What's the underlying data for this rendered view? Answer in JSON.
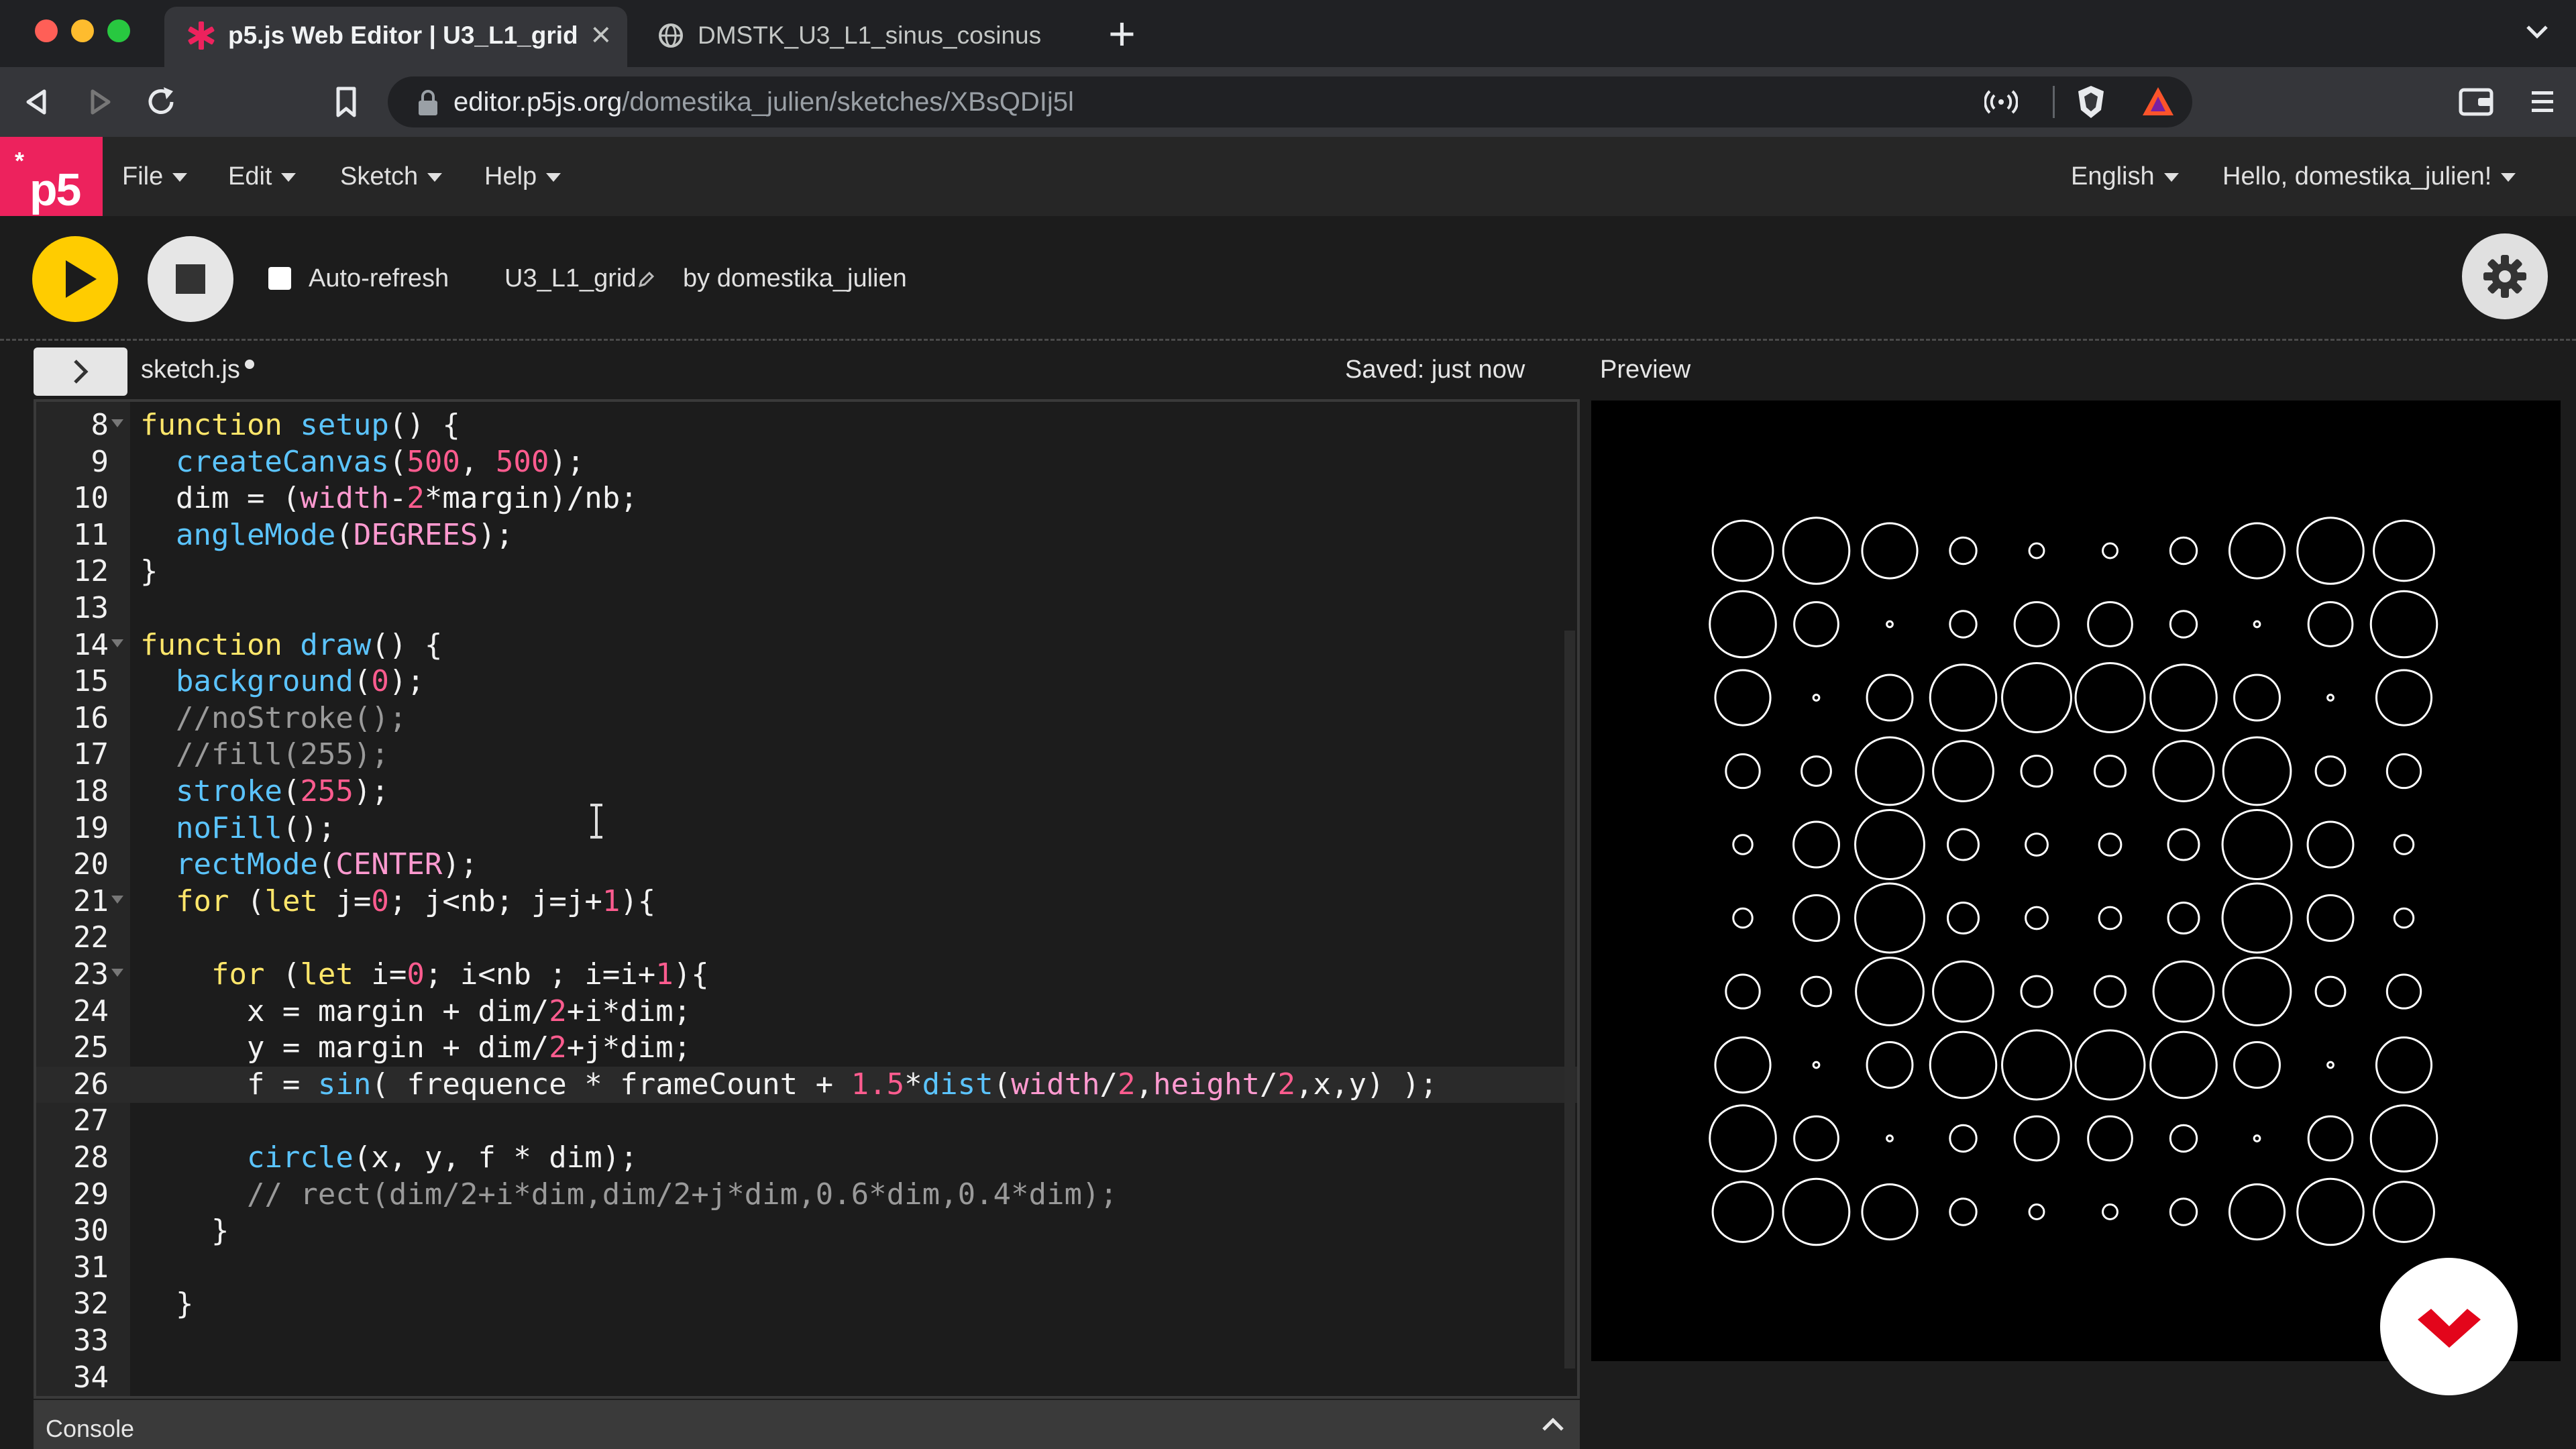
{
  "browser": {
    "tabs": [
      {
        "title": "p5.js Web Editor | U3_L1_grid",
        "active": true,
        "favicon": "p5-asterisk-icon"
      },
      {
        "title": "DMSTK_U3_L1_sinus_cosinus",
        "active": false,
        "favicon": "globe-icon"
      }
    ],
    "url_host": "editor.p5js.org",
    "url_path": "/domestika_julien/sketches/XBsQDIj5l"
  },
  "menu": {
    "logo": "p5",
    "items": [
      "File",
      "Edit",
      "Sketch",
      "Help"
    ],
    "language": "English",
    "user": "Hello, domestika_julien!"
  },
  "toolbar": {
    "auto_refresh_label": "Auto-refresh",
    "auto_refresh_checked": false,
    "sketch_name": "U3_L1_grid",
    "author": "by domestika_julien"
  },
  "editor": {
    "file_name": "sketch.js",
    "saved_status": "Saved: just now",
    "preview_label": "Preview",
    "active_line": 26,
    "lines": [
      {
        "n": "8",
        "fold": true,
        "text": "function setup() {"
      },
      {
        "n": "9",
        "fold": false,
        "text": "  createCanvas(500, 500);"
      },
      {
        "n": "10",
        "fold": false,
        "text": "  dim = (width-2*margin)/nb;"
      },
      {
        "n": "11",
        "fold": false,
        "text": "  angleMode(DEGREES);"
      },
      {
        "n": "12",
        "fold": false,
        "text": "}"
      },
      {
        "n": "13",
        "fold": false,
        "text": ""
      },
      {
        "n": "14",
        "fold": true,
        "text": "function draw() {"
      },
      {
        "n": "15",
        "fold": false,
        "text": "  background(0);"
      },
      {
        "n": "16",
        "fold": false,
        "text": "  //noStroke();"
      },
      {
        "n": "17",
        "fold": false,
        "text": "  //fill(255);"
      },
      {
        "n": "18",
        "fold": false,
        "text": "  stroke(255);"
      },
      {
        "n": "19",
        "fold": false,
        "text": "  noFill();"
      },
      {
        "n": "20",
        "fold": false,
        "text": "  rectMode(CENTER);"
      },
      {
        "n": "21",
        "fold": true,
        "text": "  for (let j=0; j<nb; j=j+1){"
      },
      {
        "n": "22",
        "fold": false,
        "text": ""
      },
      {
        "n": "23",
        "fold": true,
        "text": "    for (let i=0; i<nb ; i=i+1){"
      },
      {
        "n": "24",
        "fold": false,
        "text": "      x = margin + dim/2+i*dim;"
      },
      {
        "n": "25",
        "fold": false,
        "text": "      y = margin + dim/2+j*dim;"
      },
      {
        "n": "26",
        "fold": false,
        "text": "      f = sin( frequence * frameCount + 1.5*dist(width/2,height/2,x,y) );"
      },
      {
        "n": "27",
        "fold": false,
        "text": ""
      },
      {
        "n": "28",
        "fold": false,
        "text": "      circle(x, y, f * dim);"
      },
      {
        "n": "29",
        "fold": false,
        "text": "      // rect(dim/2+i*dim,dim/2+j*dim,0.6*dim,0.4*dim);"
      },
      {
        "n": "30",
        "fold": false,
        "text": "    }"
      },
      {
        "n": "31",
        "fold": false,
        "text": ""
      },
      {
        "n": "32",
        "fold": false,
        "text": "  }"
      },
      {
        "n": "33",
        "fold": false,
        "text": ""
      },
      {
        "n": "34",
        "fold": false,
        "text": ""
      }
    ]
  },
  "console": {
    "label": "Console"
  },
  "preview": {
    "grid_size": 10,
    "circle_diameters": [
      [
        0.82,
        0.9,
        0.75,
        0.36,
        0.2,
        0.2,
        0.36,
        0.75,
        0.9,
        0.82
      ],
      [
        0.9,
        0.6,
        0.08,
        0.36,
        0.6,
        0.6,
        0.36,
        0.08,
        0.6,
        0.9
      ],
      [
        0.75,
        0.08,
        0.62,
        0.9,
        0.94,
        0.94,
        0.9,
        0.62,
        0.08,
        0.75
      ],
      [
        0.46,
        0.4,
        0.92,
        0.82,
        0.42,
        0.42,
        0.82,
        0.92,
        0.4,
        0.46
      ],
      [
        0.26,
        0.62,
        0.94,
        0.42,
        0.3,
        0.3,
        0.42,
        0.94,
        0.62,
        0.26
      ],
      [
        0.26,
        0.62,
        0.94,
        0.42,
        0.3,
        0.3,
        0.42,
        0.94,
        0.62,
        0.26
      ],
      [
        0.46,
        0.4,
        0.92,
        0.82,
        0.42,
        0.42,
        0.82,
        0.92,
        0.4,
        0.46
      ],
      [
        0.75,
        0.08,
        0.62,
        0.9,
        0.94,
        0.94,
        0.9,
        0.62,
        0.08,
        0.75
      ],
      [
        0.9,
        0.6,
        0.08,
        0.36,
        0.6,
        0.6,
        0.36,
        0.08,
        0.6,
        0.9
      ],
      [
        0.82,
        0.9,
        0.75,
        0.36,
        0.2,
        0.2,
        0.36,
        0.75,
        0.9,
        0.82
      ]
    ]
  },
  "colors": {
    "accent_pink": "#ed225d",
    "play_yellow": "#ffcc00",
    "badge_red": "#e3051b"
  }
}
